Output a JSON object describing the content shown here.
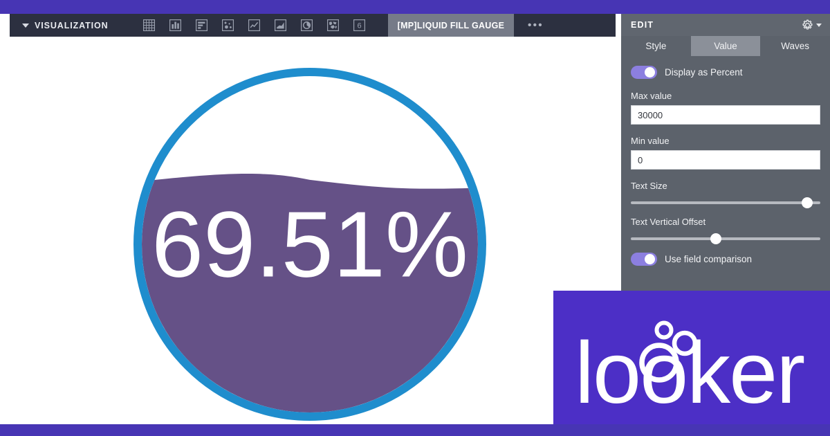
{
  "brand": {
    "band_color": "#4735b4",
    "logo_panel_color": "#4c2fc6",
    "logo_text": "looker"
  },
  "toolbar": {
    "label": "VISUALIZATION",
    "caret_icon": "chevron-down-icon",
    "chart_type_icons": [
      {
        "name": "table-chart-icon",
        "title": "Table"
      },
      {
        "name": "column-chart-icon",
        "title": "Column"
      },
      {
        "name": "bar-chart-icon",
        "title": "Bar"
      },
      {
        "name": "scatter-chart-icon",
        "title": "Scatterplot"
      },
      {
        "name": "line-chart-icon",
        "title": "Line"
      },
      {
        "name": "area-chart-icon",
        "title": "Area"
      },
      {
        "name": "pie-chart-icon",
        "title": "Pie"
      },
      {
        "name": "map-chart-icon",
        "title": "Map"
      },
      {
        "name": "single-value-icon",
        "title": "Single Value"
      }
    ],
    "active_tab": "[MP]LIQUID FILL GAUGE",
    "more_label": "•••"
  },
  "gauge": {
    "value_text": "69.51%",
    "fill_percent": 69.51,
    "ring_color": "#1f8dcd",
    "fill_color": "#655187",
    "text_color": "#ffffff",
    "background_color": "#ffffff"
  },
  "edit_panel": {
    "title": "EDIT",
    "gear_icon": "gear-icon",
    "gear_caret_icon": "chevron-down-icon",
    "tabs": [
      {
        "label": "Style",
        "active": false
      },
      {
        "label": "Value",
        "active": true
      },
      {
        "label": "Waves",
        "active": false
      }
    ],
    "display_as_percent": {
      "label": "Display as Percent",
      "on": true
    },
    "max_value": {
      "label": "Max value",
      "value": "30000",
      "placeholder": "Max value"
    },
    "min_value": {
      "label": "Min value",
      "value": "0",
      "placeholder": "Min value"
    },
    "text_size": {
      "label": "Text Size",
      "percent": 93
    },
    "text_vertical_offset": {
      "label": "Text Vertical Offset",
      "percent": 45
    },
    "use_field_comparison": {
      "label": "Use field comparison",
      "on": true
    },
    "toggle_on_color": "#8c7fe0",
    "panel_bg": "#5c626b",
    "header_bg": "#60666f",
    "active_tab_bg": "#8b9099"
  },
  "chart_data": {
    "type": "gauge",
    "title": "[MP]LIQUID FILL GAUGE",
    "value": 69.51,
    "value_label": "69.51%",
    "min": 0,
    "max": 30000,
    "unit": "percent",
    "display_as_percent": true,
    "fill_color": "#655187",
    "ring_color": "#1f8dcd"
  }
}
